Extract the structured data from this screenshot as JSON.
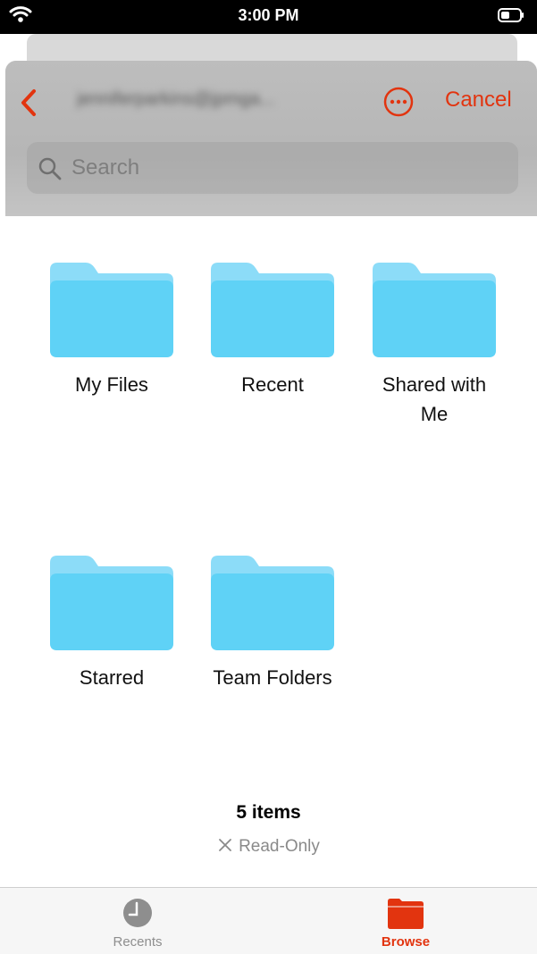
{
  "status_bar": {
    "time": "3:00 PM"
  },
  "header": {
    "account_name": "jenniferparkins@jpmga...",
    "cancel_label": "Cancel",
    "back_icon": "chevron-left-icon",
    "more_icon": "ellipsis-circle-icon"
  },
  "search": {
    "placeholder": "Search"
  },
  "folders": [
    {
      "label": "My Files"
    },
    {
      "label": "Recent"
    },
    {
      "label": "Shared with Me"
    },
    {
      "label": "Starred"
    },
    {
      "label": "Team Folders"
    }
  ],
  "footer": {
    "count": "5 items",
    "read_only": "Read-Only"
  },
  "tabs": [
    {
      "label": "Recents",
      "icon": "clock-icon",
      "active": false
    },
    {
      "label": "Browse",
      "icon": "folder-icon",
      "active": true
    }
  ],
  "colors": {
    "accent": "#e2340f",
    "folder": "#5fd2f6",
    "folder_back": "#8cdcf8"
  }
}
